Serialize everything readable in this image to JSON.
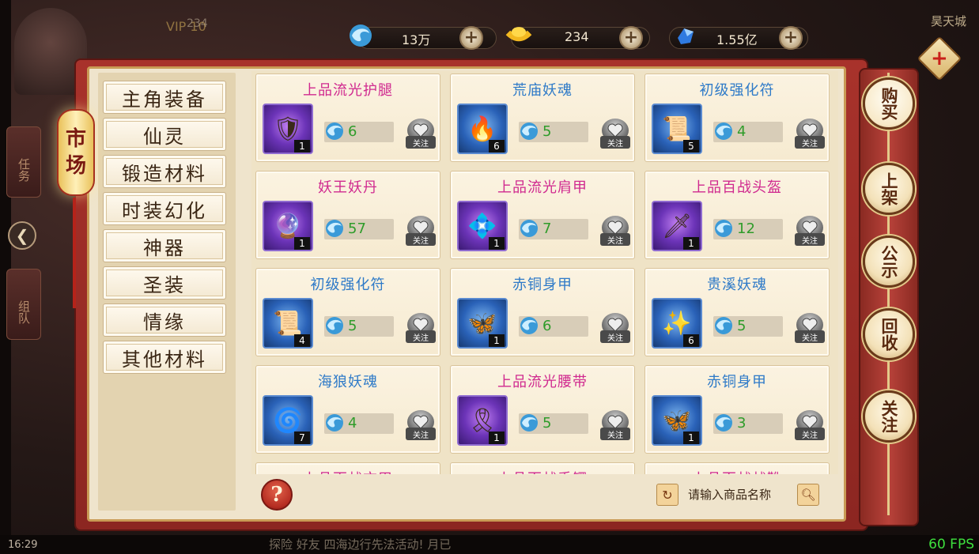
{
  "hud": {
    "city": "昊天城",
    "vip": "VIP 10",
    "player_gold_small": "234",
    "time": "16:29",
    "ping": "21ms",
    "fps": "60 FPS",
    "side_tab_task": "任务",
    "side_tab_team": "组队",
    "bottom_text": "探险 好友 四海边行先法活动! 月已"
  },
  "currencies": [
    {
      "icon": "blue-jade-icon",
      "value": "13万"
    },
    {
      "icon": "gold-ingot-icon",
      "value": "234"
    },
    {
      "icon": "blue-crystal-icon",
      "value": "1.55亿"
    }
  ],
  "market_title": [
    "市",
    "场"
  ],
  "categories": [
    "主角装备",
    "仙灵",
    "锻造材料",
    "时装幻化",
    "神器",
    "圣装",
    "情缘",
    "其他材料"
  ],
  "items": [
    {
      "name": "上品流光护腿",
      "color": "pink",
      "icon_bg": "purple",
      "glyph": "🛡",
      "count": "1",
      "price": "6"
    },
    {
      "name": "荒庙妖魂",
      "color": "blue",
      "icon_bg": "blue",
      "glyph": "🔥",
      "count": "6",
      "price": "5"
    },
    {
      "name": "初级强化符",
      "color": "blue",
      "icon_bg": "blue",
      "glyph": "📜",
      "count": "5",
      "price": "4"
    },
    {
      "name": "妖王妖丹",
      "color": "pink",
      "icon_bg": "purple",
      "glyph": "🔮",
      "count": "1",
      "price": "57"
    },
    {
      "name": "上品流光肩甲",
      "color": "pink",
      "icon_bg": "purple",
      "glyph": "💠",
      "count": "1",
      "price": "7"
    },
    {
      "name": "上品百战头盔",
      "color": "pink",
      "icon_bg": "purple",
      "glyph": "🗡",
      "count": "1",
      "price": "12"
    },
    {
      "name": "初级强化符",
      "color": "blue",
      "icon_bg": "blue",
      "glyph": "📜",
      "count": "4",
      "price": "5"
    },
    {
      "name": "赤铜身甲",
      "color": "blue",
      "icon_bg": "blue",
      "glyph": "🦋",
      "count": "1",
      "price": "6"
    },
    {
      "name": "贵溪妖魂",
      "color": "blue",
      "icon_bg": "blue",
      "glyph": "✨",
      "count": "6",
      "price": "5"
    },
    {
      "name": "海狼妖魂",
      "color": "blue",
      "icon_bg": "blue",
      "glyph": "🌀",
      "count": "7",
      "price": "4"
    },
    {
      "name": "上品流光腰带",
      "color": "pink",
      "icon_bg": "purple",
      "glyph": "🎗",
      "count": "1",
      "price": "5"
    },
    {
      "name": "赤铜身甲",
      "color": "blue",
      "icon_bg": "blue",
      "glyph": "🦋",
      "count": "1",
      "price": "3"
    }
  ],
  "partial_items": [
    "上品百战衣甲",
    "上品百战手镯",
    "上品百战战靴"
  ],
  "follow_label": "关注",
  "search": {
    "placeholder": "请输入商品名称"
  },
  "help_label": "?",
  "side_buttons": [
    "购买",
    "上架",
    "公示",
    "回收",
    "关注"
  ]
}
